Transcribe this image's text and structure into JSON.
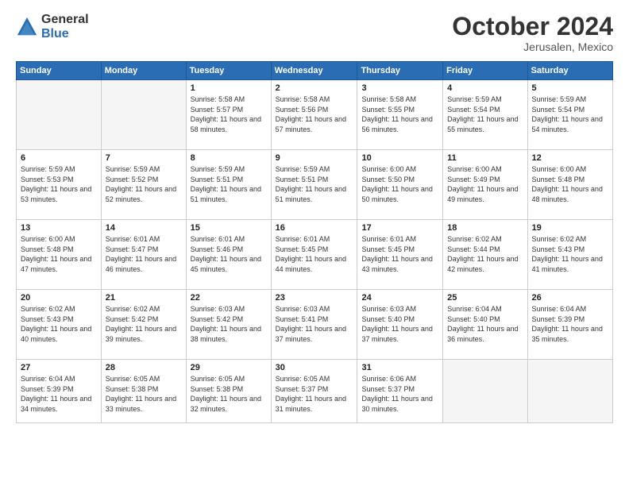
{
  "logo": {
    "general": "General",
    "blue": "Blue"
  },
  "header": {
    "month": "October 2024",
    "location": "Jerusalen, Mexico"
  },
  "weekdays": [
    "Sunday",
    "Monday",
    "Tuesday",
    "Wednesday",
    "Thursday",
    "Friday",
    "Saturday"
  ],
  "weeks": [
    [
      {
        "day": "",
        "info": ""
      },
      {
        "day": "",
        "info": ""
      },
      {
        "day": "1",
        "info": "Sunrise: 5:58 AM\nSunset: 5:57 PM\nDaylight: 11 hours and 58 minutes."
      },
      {
        "day": "2",
        "info": "Sunrise: 5:58 AM\nSunset: 5:56 PM\nDaylight: 11 hours and 57 minutes."
      },
      {
        "day": "3",
        "info": "Sunrise: 5:58 AM\nSunset: 5:55 PM\nDaylight: 11 hours and 56 minutes."
      },
      {
        "day": "4",
        "info": "Sunrise: 5:59 AM\nSunset: 5:54 PM\nDaylight: 11 hours and 55 minutes."
      },
      {
        "day": "5",
        "info": "Sunrise: 5:59 AM\nSunset: 5:54 PM\nDaylight: 11 hours and 54 minutes."
      }
    ],
    [
      {
        "day": "6",
        "info": "Sunrise: 5:59 AM\nSunset: 5:53 PM\nDaylight: 11 hours and 53 minutes."
      },
      {
        "day": "7",
        "info": "Sunrise: 5:59 AM\nSunset: 5:52 PM\nDaylight: 11 hours and 52 minutes."
      },
      {
        "day": "8",
        "info": "Sunrise: 5:59 AM\nSunset: 5:51 PM\nDaylight: 11 hours and 51 minutes."
      },
      {
        "day": "9",
        "info": "Sunrise: 5:59 AM\nSunset: 5:51 PM\nDaylight: 11 hours and 51 minutes."
      },
      {
        "day": "10",
        "info": "Sunrise: 6:00 AM\nSunset: 5:50 PM\nDaylight: 11 hours and 50 minutes."
      },
      {
        "day": "11",
        "info": "Sunrise: 6:00 AM\nSunset: 5:49 PM\nDaylight: 11 hours and 49 minutes."
      },
      {
        "day": "12",
        "info": "Sunrise: 6:00 AM\nSunset: 5:48 PM\nDaylight: 11 hours and 48 minutes."
      }
    ],
    [
      {
        "day": "13",
        "info": "Sunrise: 6:00 AM\nSunset: 5:48 PM\nDaylight: 11 hours and 47 minutes."
      },
      {
        "day": "14",
        "info": "Sunrise: 6:01 AM\nSunset: 5:47 PM\nDaylight: 11 hours and 46 minutes."
      },
      {
        "day": "15",
        "info": "Sunrise: 6:01 AM\nSunset: 5:46 PM\nDaylight: 11 hours and 45 minutes."
      },
      {
        "day": "16",
        "info": "Sunrise: 6:01 AM\nSunset: 5:45 PM\nDaylight: 11 hours and 44 minutes."
      },
      {
        "day": "17",
        "info": "Sunrise: 6:01 AM\nSunset: 5:45 PM\nDaylight: 11 hours and 43 minutes."
      },
      {
        "day": "18",
        "info": "Sunrise: 6:02 AM\nSunset: 5:44 PM\nDaylight: 11 hours and 42 minutes."
      },
      {
        "day": "19",
        "info": "Sunrise: 6:02 AM\nSunset: 5:43 PM\nDaylight: 11 hours and 41 minutes."
      }
    ],
    [
      {
        "day": "20",
        "info": "Sunrise: 6:02 AM\nSunset: 5:43 PM\nDaylight: 11 hours and 40 minutes."
      },
      {
        "day": "21",
        "info": "Sunrise: 6:02 AM\nSunset: 5:42 PM\nDaylight: 11 hours and 39 minutes."
      },
      {
        "day": "22",
        "info": "Sunrise: 6:03 AM\nSunset: 5:42 PM\nDaylight: 11 hours and 38 minutes."
      },
      {
        "day": "23",
        "info": "Sunrise: 6:03 AM\nSunset: 5:41 PM\nDaylight: 11 hours and 37 minutes."
      },
      {
        "day": "24",
        "info": "Sunrise: 6:03 AM\nSunset: 5:40 PM\nDaylight: 11 hours and 37 minutes."
      },
      {
        "day": "25",
        "info": "Sunrise: 6:04 AM\nSunset: 5:40 PM\nDaylight: 11 hours and 36 minutes."
      },
      {
        "day": "26",
        "info": "Sunrise: 6:04 AM\nSunset: 5:39 PM\nDaylight: 11 hours and 35 minutes."
      }
    ],
    [
      {
        "day": "27",
        "info": "Sunrise: 6:04 AM\nSunset: 5:39 PM\nDaylight: 11 hours and 34 minutes."
      },
      {
        "day": "28",
        "info": "Sunrise: 6:05 AM\nSunset: 5:38 PM\nDaylight: 11 hours and 33 minutes."
      },
      {
        "day": "29",
        "info": "Sunrise: 6:05 AM\nSunset: 5:38 PM\nDaylight: 11 hours and 32 minutes."
      },
      {
        "day": "30",
        "info": "Sunrise: 6:05 AM\nSunset: 5:37 PM\nDaylight: 11 hours and 31 minutes."
      },
      {
        "day": "31",
        "info": "Sunrise: 6:06 AM\nSunset: 5:37 PM\nDaylight: 11 hours and 30 minutes."
      },
      {
        "day": "",
        "info": ""
      },
      {
        "day": "",
        "info": ""
      }
    ]
  ]
}
